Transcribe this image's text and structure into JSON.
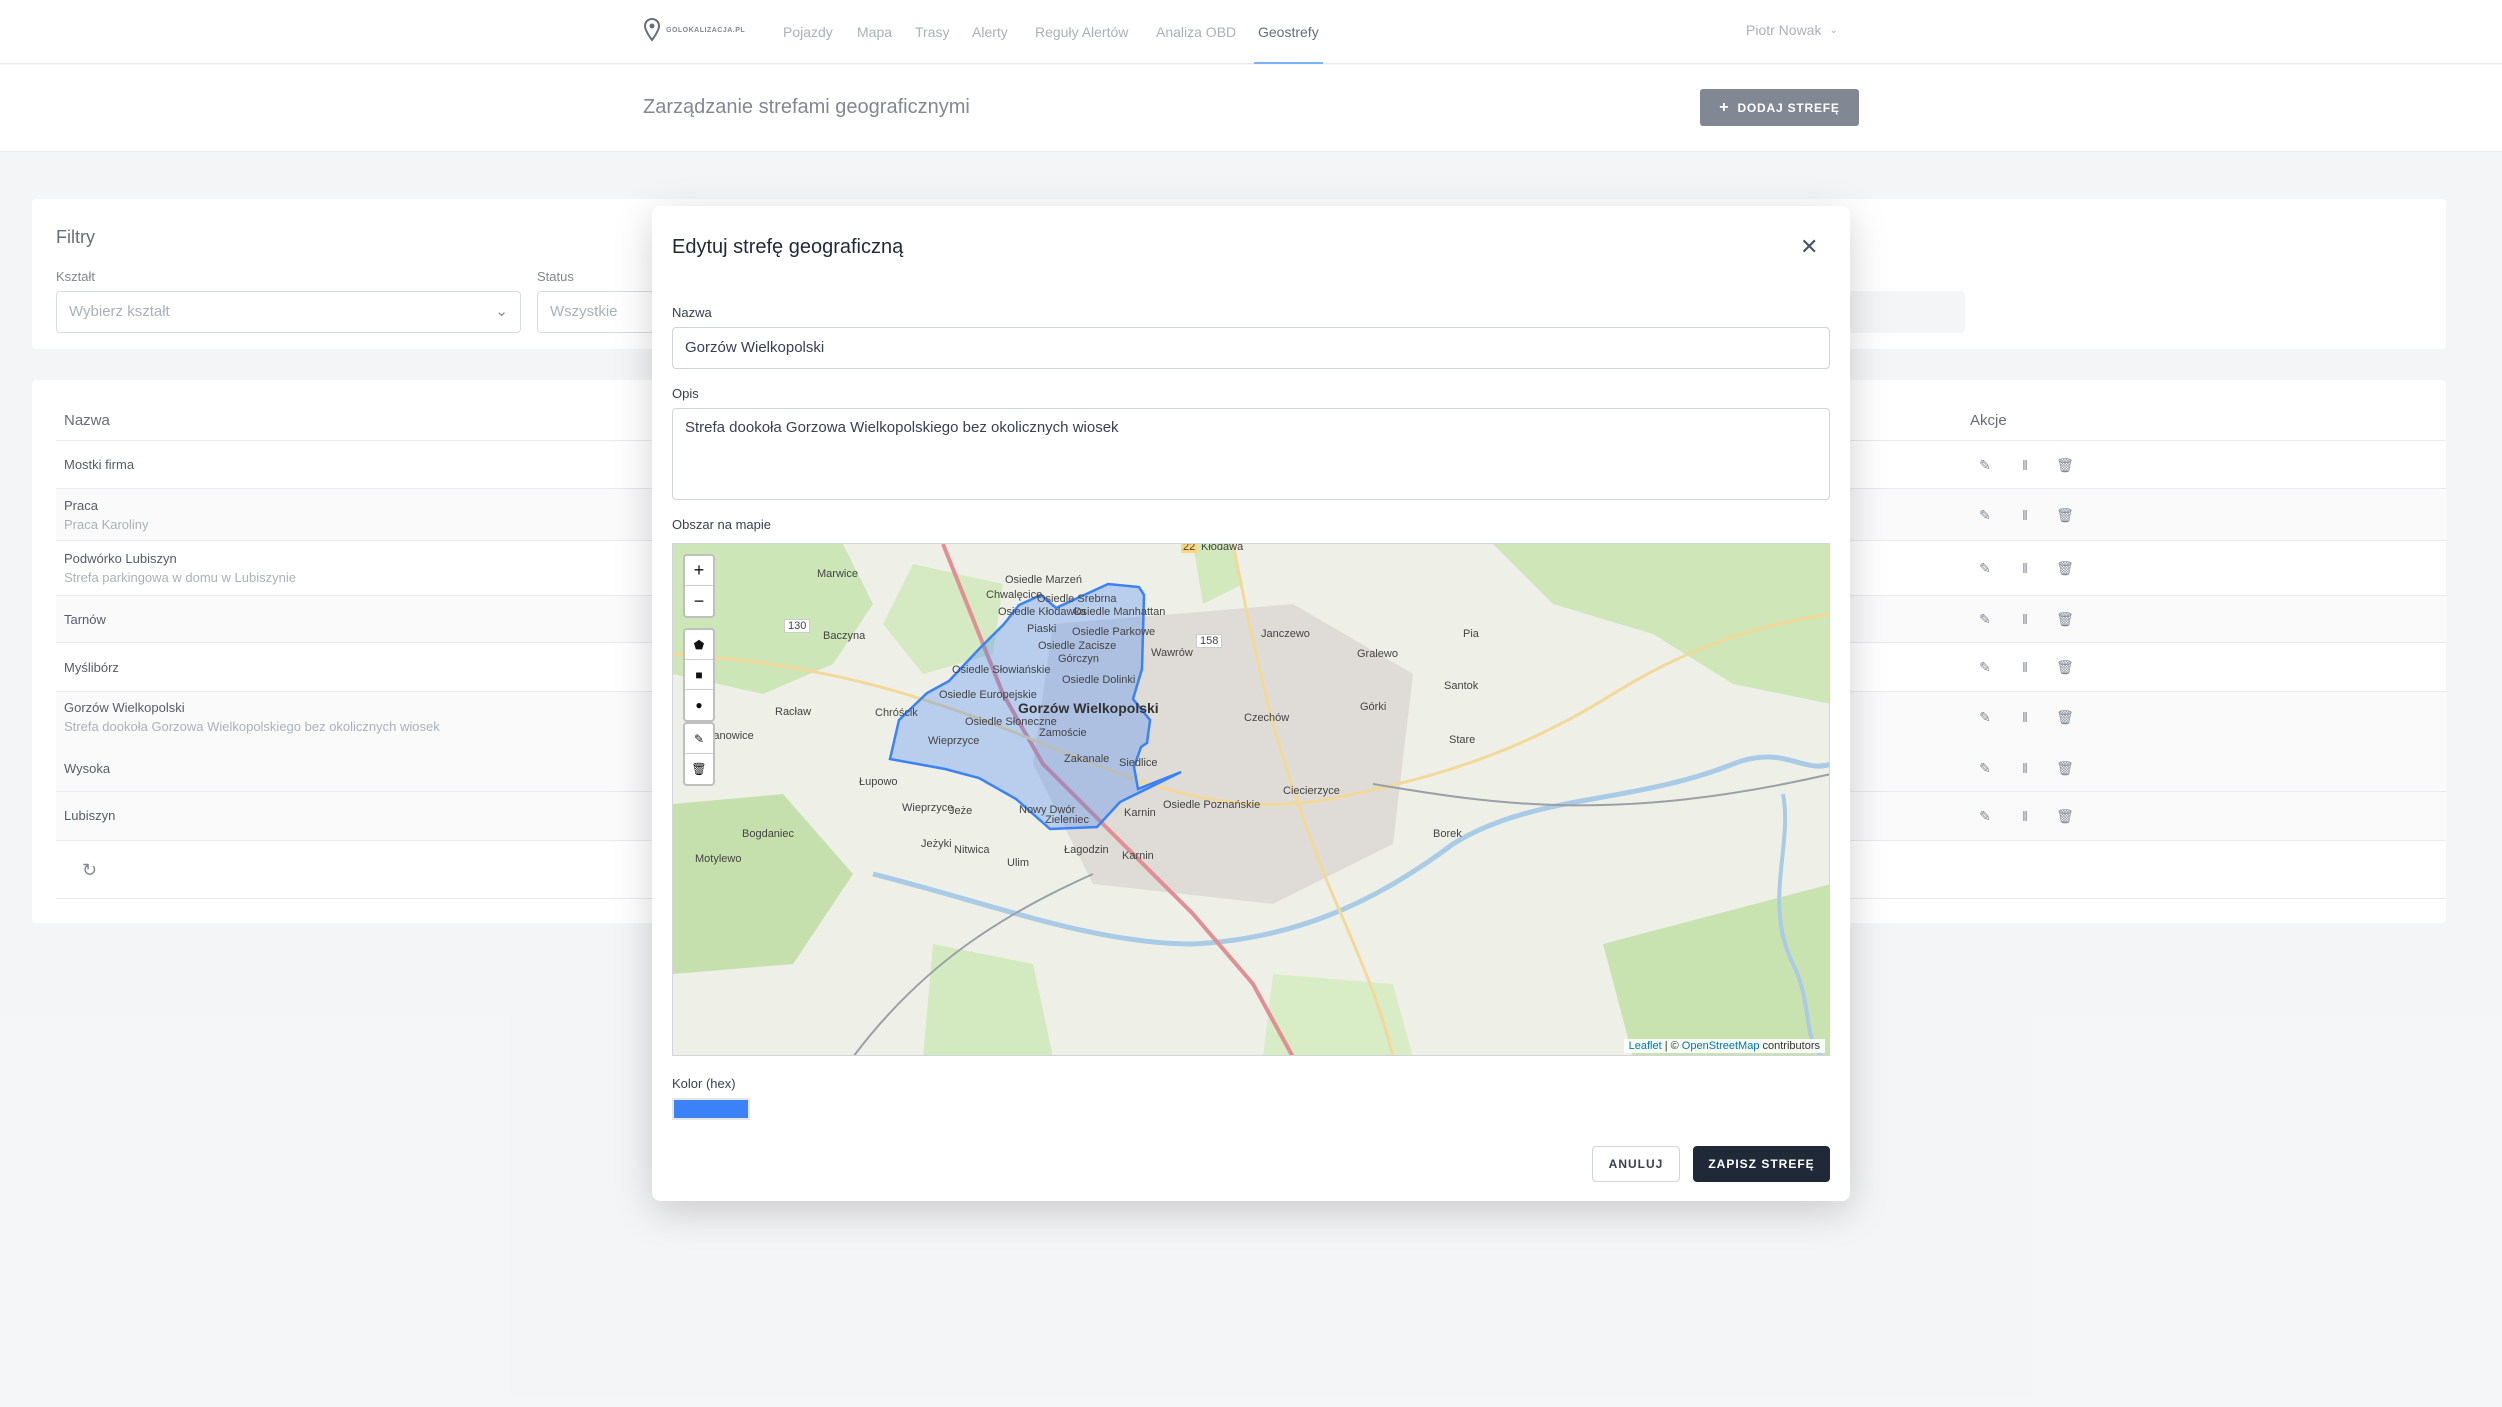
{
  "nav": {
    "logo_text": "GOLOKALIZACJA.PL",
    "items": [
      "Pojazdy",
      "Mapa",
      "Trasy",
      "Alerty",
      "Reguły Alertów",
      "Analiza OBD",
      "Geostrefy"
    ],
    "active": "Geostrefy",
    "user": "Piotr Nowak"
  },
  "header": {
    "title": "Zarządzanie strefami geograficznymi",
    "add_button": "DODAJ STREFĘ"
  },
  "filters": {
    "title": "Filtry",
    "shape_label": "Kształt",
    "shape_placeholder": "Wybierz kształt",
    "status_label": "Status",
    "status_value": "Wszystkie"
  },
  "table": {
    "col_name": "Nazwa",
    "col_actions": "Akcje",
    "rows": [
      {
        "name": "Mostki firma",
        "desc": ""
      },
      {
        "name": "Praca",
        "desc": "Praca Karoliny"
      },
      {
        "name": "Podwórko Lubiszyn",
        "desc": "Strefa parkingowa w domu w Lubiszynie"
      },
      {
        "name": "Tarnów",
        "desc": ""
      },
      {
        "name": "Myślibórz",
        "desc": ""
      },
      {
        "name": "Gorzów Wielkopolski",
        "desc": "Strefa dookoła Gorzowa Wielkopolskiego bez okolicznych wiosek"
      },
      {
        "name": "Wysoka",
        "desc": ""
      },
      {
        "name": "Lubiszyn",
        "desc": ""
      }
    ]
  },
  "modal": {
    "title": "Edytuj strefę geograficzną",
    "name_label": "Nazwa",
    "name_value": "Gorzów Wielkopolski",
    "desc_label": "Opis",
    "desc_value": "Strefa dookoła Gorzowa Wielkopolskiego bez okolicznych wiosek",
    "map_label": "Obszar na mapie",
    "color_label": "Kolor (hex)",
    "color_value": "#3b82f6",
    "cancel": "ANULUJ",
    "save": "ZAPISZ STREFĘ"
  },
  "map": {
    "attribution_leaflet": "Leaflet",
    "attribution_sep": "| ©",
    "attribution_osm": "OpenStreetMap",
    "attribution_contrib": "contributors",
    "places": [
      "Kłodawa",
      "Marwice",
      "Osiedle Marzeń",
      "Chwalęcice",
      "Osiedle Srebrna",
      "Osiedle Kłodawka",
      "Osiedle Manhattan",
      "Piaski",
      "Osiedle Parkowe",
      "Osiedle Zacisze",
      "Górczyn",
      "Baczyna",
      "Osiedle Słowiańskie",
      "Osiedle Dolinki",
      "Osiedle Europejskie",
      "Gorzów Wielkopolski",
      "Chróścik",
      "Racław",
      "Osiedle Słoneczne",
      "Zamoście",
      "Stanowice",
      "Wieprzyce",
      "Zakanale",
      "Siedlice",
      "Łupowo",
      "Wieprzyce",
      "Jeże",
      "Nowy Dwór",
      "Zieleniec",
      "Karnin",
      "Osiedle Poznańskie",
      "Bogdaniec",
      "Jeżyki",
      "Nitwica",
      "Łagodzin",
      "Karnin",
      "Motylewo",
      "Ulim",
      "Janczewo",
      "Gralewo",
      "Górki",
      "Santok",
      "Czechów",
      "Ciecierzyce",
      "Borek",
      "Wawrów",
      "Pia",
      "Stare"
    ],
    "roads": [
      "22",
      "130",
      "158"
    ]
  }
}
